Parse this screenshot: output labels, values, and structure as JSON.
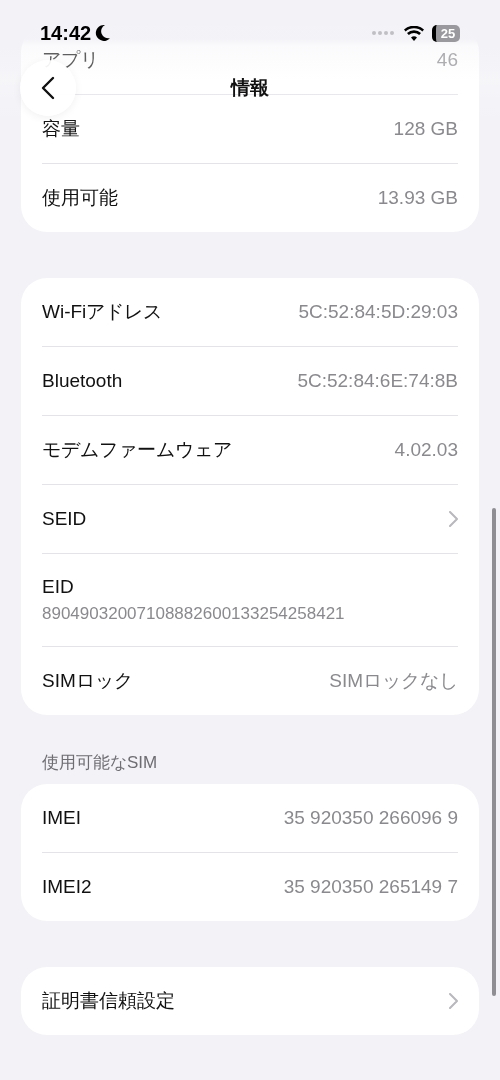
{
  "status_bar": {
    "time": "14:42",
    "battery": "25"
  },
  "nav": {
    "title": "情報"
  },
  "sections": [
    {
      "rows": [
        {
          "kind": "value",
          "label": "アプリ",
          "value": "46"
        },
        {
          "kind": "value",
          "label": "容量",
          "value": "128 GB"
        },
        {
          "kind": "value",
          "label": "使用可能",
          "value": "13.93 GB"
        }
      ]
    },
    {
      "rows": [
        {
          "kind": "value",
          "label": "Wi-Fiアドレス",
          "value": "5C:52:84:5D:29:03"
        },
        {
          "kind": "value",
          "label": "Bluetooth",
          "value": "5C:52:84:6E:74:8B"
        },
        {
          "kind": "value",
          "label": "モデムファームウェア",
          "value": "4.02.03"
        },
        {
          "kind": "link",
          "label": "SEID"
        },
        {
          "kind": "stacked",
          "label": "EID",
          "value": "89049032007108882600133254258421"
        },
        {
          "kind": "value",
          "label": "SIMロック",
          "value": "SIMロックなし"
        }
      ]
    },
    {
      "header": "使用可能なSIM",
      "rows": [
        {
          "kind": "value",
          "label": "IMEI",
          "value": "35 920350 266096 9"
        },
        {
          "kind": "value",
          "label": "IMEI2",
          "value": "35 920350 265149 7"
        }
      ]
    },
    {
      "rows": [
        {
          "kind": "link",
          "label": "証明書信頼設定"
        }
      ]
    }
  ]
}
